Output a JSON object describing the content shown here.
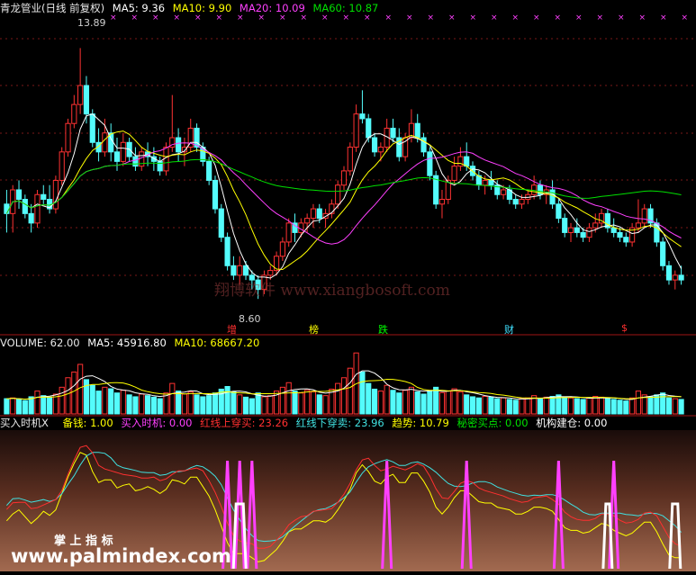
{
  "price_header": {
    "title": "青龙管业(日线 前复权)",
    "ma5": "MA5: 9.36",
    "ma10": "MA10: 9.90",
    "ma20": "MA20: 10.09",
    "ma60": "MA60: 10.87"
  },
  "volume_header": {
    "label": "VOLUME: 62.00",
    "ma5": "MA5: 45916.80",
    "ma10": "MA10: 68667.20"
  },
  "indicator_header": {
    "name": "买入时机X",
    "items": [
      {
        "text": "备钱: 1.00",
        "color": "#ffff00"
      },
      {
        "text": "买入时机: 0.00",
        "color": "#ff40ff"
      },
      {
        "text": "红线上穿买: 23.26",
        "color": "#ff3030"
      },
      {
        "text": "红线下穿卖: 23.96",
        "color": "#40e0e0"
      },
      {
        "text": "趋势: 10.79",
        "color": "#ffff00"
      },
      {
        "text": "秘密买点: 0.00",
        "color": "#00e000"
      },
      {
        "text": "机构建仓: 0.00",
        "color": "#ffffff"
      }
    ]
  },
  "watermark": "翔博软件 www.xiangbosoft.com",
  "bottom_watermark": {
    "cn": "掌 上 指 标",
    "url": "www.palmindex.com"
  },
  "markers": [
    {
      "text": "增",
      "color": "#ff3030"
    },
    {
      "text": "榜",
      "color": "#ffff00"
    },
    {
      "text": "跌",
      "color": "#00ff00"
    },
    {
      "text": "财",
      "color": "#40e0ff"
    },
    {
      "text": "$",
      "color": "#ff3030"
    }
  ],
  "colors": {
    "up": "#ff3232",
    "down": "#54fcfc",
    "ma5": "#ffffff",
    "ma10": "#ffff00",
    "ma20": "#ff40ff",
    "ma60": "#00e000"
  },
  "chart_data": {
    "type": "candlestick",
    "high_label": "13.89",
    "low_label": "8.60",
    "candles": [
      [
        10.6,
        10.9,
        10.0,
        10.4
      ],
      [
        10.4,
        11.0,
        10.0,
        10.9
      ],
      [
        10.9,
        11.1,
        10.5,
        10.7
      ],
      [
        10.7,
        10.8,
        10.3,
        10.4
      ],
      [
        10.4,
        10.6,
        10.0,
        10.2
      ],
      [
        10.2,
        10.9,
        10.1,
        10.8
      ],
      [
        10.8,
        11.0,
        10.6,
        10.7
      ],
      [
        10.7,
        11.0,
        10.4,
        10.5
      ],
      [
        10.5,
        11.2,
        10.4,
        11.1
      ],
      [
        11.1,
        11.8,
        11.0,
        11.7
      ],
      [
        11.7,
        12.4,
        11.6,
        12.3
      ],
      [
        12.3,
        12.9,
        12.2,
        12.7
      ],
      [
        12.7,
        13.89,
        12.5,
        13.1
      ],
      [
        13.1,
        13.3,
        12.3,
        12.5
      ],
      [
        12.5,
        12.6,
        11.8,
        11.9
      ],
      [
        11.9,
        12.2,
        11.5,
        11.7
      ],
      [
        11.7,
        12.4,
        11.6,
        12.1
      ],
      [
        12.1,
        12.3,
        11.5,
        11.7
      ],
      [
        11.7,
        12.0,
        11.3,
        11.5
      ],
      [
        11.5,
        12.1,
        11.4,
        11.9
      ],
      [
        11.9,
        12.0,
        11.5,
        11.6
      ],
      [
        11.6,
        11.8,
        11.3,
        11.4
      ],
      [
        11.4,
        11.8,
        11.3,
        11.7
      ],
      [
        11.7,
        11.9,
        11.4,
        11.6
      ],
      [
        11.6,
        11.8,
        11.3,
        11.5
      ],
      [
        11.5,
        11.6,
        11.2,
        11.3
      ],
      [
        11.3,
        11.9,
        11.2,
        11.8
      ],
      [
        11.8,
        12.9,
        11.7,
        12.0
      ],
      [
        12.0,
        12.2,
        11.5,
        11.7
      ],
      [
        11.7,
        12.0,
        11.4,
        11.8
      ],
      [
        11.8,
        12.4,
        11.7,
        12.2
      ],
      [
        12.2,
        12.3,
        11.7,
        11.8
      ],
      [
        11.8,
        11.9,
        11.4,
        11.5
      ],
      [
        11.5,
        11.6,
        11.0,
        11.1
      ],
      [
        11.1,
        11.2,
        10.4,
        10.5
      ],
      [
        10.5,
        10.6,
        9.8,
        9.9
      ],
      [
        9.9,
        10.0,
        9.2,
        9.3
      ],
      [
        9.3,
        9.5,
        9.0,
        9.1
      ],
      [
        9.1,
        9.5,
        8.9,
        9.3
      ],
      [
        9.3,
        9.4,
        9.0,
        9.1
      ],
      [
        9.1,
        9.2,
        8.8,
        9.0
      ],
      [
        9.0,
        9.1,
        8.6,
        8.8
      ],
      [
        8.8,
        9.2,
        8.7,
        9.1
      ],
      [
        9.1,
        9.3,
        9.0,
        9.2
      ],
      [
        9.2,
        9.6,
        9.1,
        9.5
      ],
      [
        9.5,
        9.9,
        9.4,
        9.8
      ],
      [
        9.8,
        10.3,
        9.7,
        10.2
      ],
      [
        10.2,
        10.4,
        9.8,
        10.0
      ],
      [
        10.0,
        10.3,
        9.9,
        10.2
      ],
      [
        10.2,
        10.4,
        10.0,
        10.3
      ],
      [
        10.3,
        10.6,
        10.1,
        10.5
      ],
      [
        10.5,
        10.6,
        10.2,
        10.3
      ],
      [
        10.3,
        10.5,
        10.1,
        10.4
      ],
      [
        10.4,
        10.7,
        10.3,
        10.6
      ],
      [
        10.6,
        11.1,
        10.5,
        11.0
      ],
      [
        11.0,
        11.4,
        10.9,
        11.3
      ],
      [
        11.3,
        11.9,
        11.2,
        11.8
      ],
      [
        11.8,
        12.7,
        11.7,
        12.5
      ],
      [
        12.5,
        13.0,
        12.3,
        12.4
      ],
      [
        12.4,
        12.5,
        11.9,
        12.0
      ],
      [
        12.0,
        12.1,
        11.6,
        11.7
      ],
      [
        11.7,
        11.9,
        11.5,
        11.8
      ],
      [
        11.8,
        12.4,
        11.7,
        12.2
      ],
      [
        12.2,
        12.4,
        11.9,
        12.0
      ],
      [
        12.0,
        12.2,
        11.5,
        11.6
      ],
      [
        11.6,
        12.1,
        11.5,
        12.0
      ],
      [
        12.0,
        12.6,
        11.9,
        12.3
      ],
      [
        12.3,
        12.5,
        11.9,
        12.0
      ],
      [
        12.0,
        12.1,
        11.6,
        11.7
      ],
      [
        11.7,
        11.8,
        11.1,
        11.2
      ],
      [
        11.2,
        11.3,
        10.5,
        10.6
      ],
      [
        10.6,
        10.9,
        10.3,
        10.7
      ],
      [
        10.7,
        11.2,
        10.6,
        11.1
      ],
      [
        11.1,
        11.6,
        11.0,
        11.4
      ],
      [
        11.4,
        11.8,
        11.3,
        11.6
      ],
      [
        11.6,
        11.9,
        11.3,
        11.4
      ],
      [
        11.4,
        11.5,
        11.1,
        11.2
      ],
      [
        11.2,
        11.3,
        10.9,
        11.0
      ],
      [
        11.0,
        11.2,
        10.8,
        11.1
      ],
      [
        11.1,
        11.3,
        10.9,
        11.0
      ],
      [
        11.0,
        11.1,
        10.7,
        10.8
      ],
      [
        10.8,
        11.0,
        10.7,
        10.9
      ],
      [
        10.9,
        11.0,
        10.6,
        10.7
      ],
      [
        10.7,
        10.8,
        10.5,
        10.6
      ],
      [
        10.6,
        10.8,
        10.5,
        10.7
      ],
      [
        10.7,
        10.9,
        10.6,
        10.8
      ],
      [
        10.8,
        11.2,
        10.7,
        11.0
      ],
      [
        11.0,
        11.1,
        10.7,
        10.8
      ],
      [
        10.8,
        11.0,
        10.6,
        10.9
      ],
      [
        10.9,
        11.1,
        10.5,
        10.6
      ],
      [
        10.6,
        10.7,
        10.2,
        10.3
      ],
      [
        10.3,
        10.4,
        9.9,
        10.0
      ],
      [
        10.0,
        10.2,
        9.8,
        10.1
      ],
      [
        10.1,
        10.3,
        9.9,
        10.0
      ],
      [
        10.0,
        10.1,
        9.8,
        9.9
      ],
      [
        9.9,
        10.2,
        9.8,
        10.1
      ],
      [
        10.1,
        10.4,
        10.0,
        10.2
      ],
      [
        10.2,
        10.5,
        10.1,
        10.4
      ],
      [
        10.4,
        10.5,
        10.0,
        10.1
      ],
      [
        10.1,
        10.3,
        9.9,
        10.0
      ],
      [
        10.0,
        10.1,
        9.8,
        9.9
      ],
      [
        9.9,
        10.0,
        9.7,
        9.8
      ],
      [
        9.8,
        10.2,
        9.7,
        10.1
      ],
      [
        10.1,
        10.7,
        10.0,
        10.2
      ],
      [
        10.2,
        10.6,
        10.1,
        10.5
      ],
      [
        10.5,
        10.6,
        10.1,
        10.2
      ],
      [
        10.2,
        10.3,
        9.7,
        9.8
      ],
      [
        9.8,
        9.9,
        9.2,
        9.3
      ],
      [
        9.3,
        9.4,
        8.9,
        9.0
      ],
      [
        9.0,
        9.2,
        8.8,
        9.1
      ],
      [
        9.1,
        9.3,
        8.9,
        9.0
      ]
    ],
    "volume": [
      40,
      42,
      38,
      35,
      45,
      60,
      48,
      44,
      52,
      70,
      95,
      110,
      130,
      90,
      75,
      60,
      70,
      66,
      55,
      62,
      50,
      45,
      52,
      48,
      44,
      40,
      55,
      80,
      60,
      52,
      58,
      50,
      45,
      48,
      55,
      65,
      72,
      58,
      50,
      44,
      40,
      55,
      45,
      48,
      60,
      70,
      82,
      60,
      55,
      62,
      58,
      50,
      48,
      65,
      80,
      95,
      120,
      160,
      110,
      80,
      65,
      60,
      75,
      62,
      55,
      62,
      70,
      58,
      52,
      60,
      70,
      56,
      60,
      66,
      58,
      50,
      45,
      42,
      46,
      44,
      40,
      42,
      38,
      36,
      40,
      42,
      48,
      40,
      44,
      46,
      50,
      45,
      42,
      40,
      38,
      42,
      46,
      44,
      40,
      38,
      36,
      34,
      42,
      60,
      50,
      45,
      50,
      55,
      42,
      40,
      38
    ]
  }
}
